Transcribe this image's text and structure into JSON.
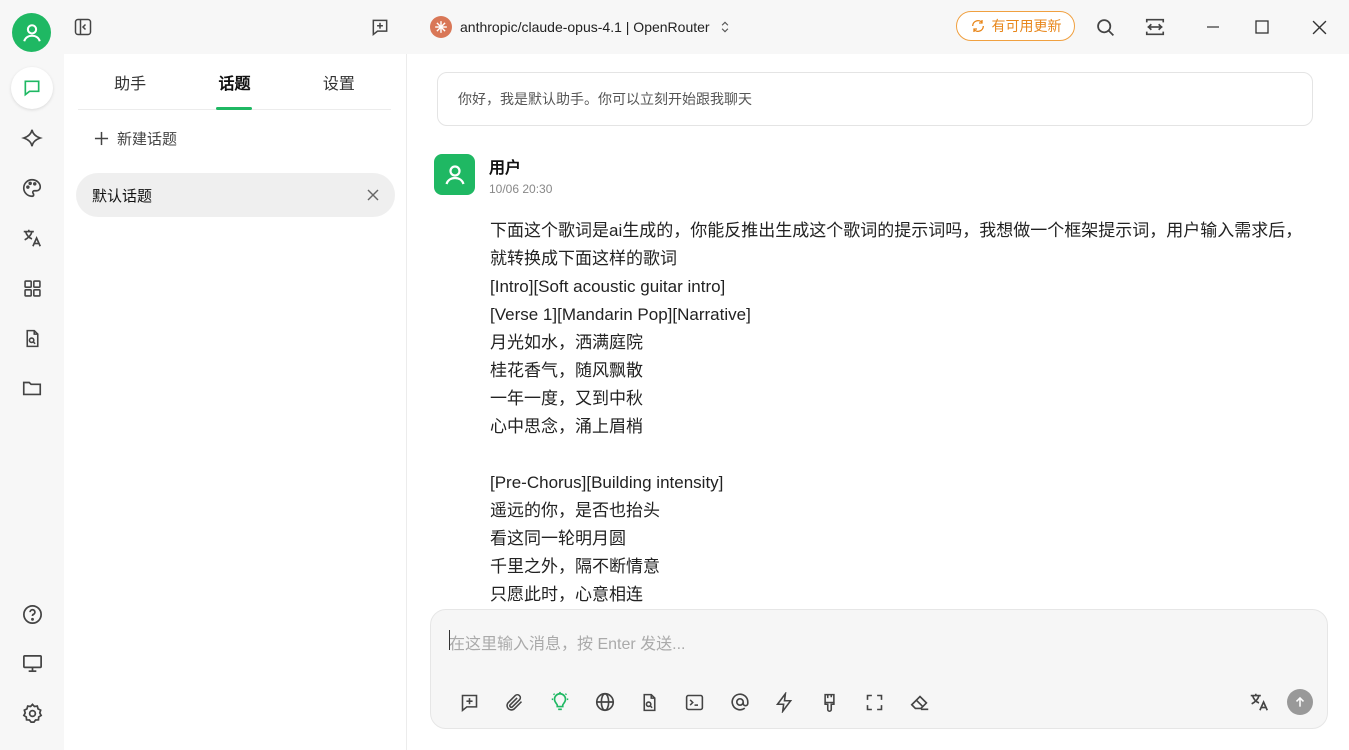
{
  "titlebar": {
    "model_name": "anthropic/claude-opus-4.1 | OpenRouter",
    "update_label": "有可用更新"
  },
  "topics_panel": {
    "tabs": [
      {
        "label": "助手"
      },
      {
        "label": "话题"
      },
      {
        "label": "设置"
      }
    ],
    "new_topic_label": "新建话题",
    "topic_items": [
      {
        "label": "默认话题"
      }
    ]
  },
  "chat": {
    "welcome": "你好，我是默认助手。你可以立刻开始跟我聊天",
    "message": {
      "user": "用户",
      "time": "10/06 20:30",
      "lines": [
        "下面这个歌词是ai生成的，你能反推出生成这个歌词的提示词吗，我想做一个框架提示词，用户输入需求后，就转换成下面这样的歌词",
        "[Intro][Soft acoustic guitar intro]",
        "[Verse 1][Mandarin Pop][Narrative]",
        "月光如水，洒满庭院",
        "桂花香气，随风飘散",
        "一年一度，又到中秋",
        "心中思念，涌上眉梢",
        "",
        "[Pre-Chorus][Building intensity]",
        "遥远的你，是否也抬头",
        "看这同一轮明月圆",
        "千里之外，隔不断情意",
        "只愿此时，心意相连"
      ]
    },
    "input_placeholder": "在这里输入消息，按 Enter 发送..."
  },
  "colors": {
    "accent": "#1fb863",
    "update": "#e8871c"
  }
}
